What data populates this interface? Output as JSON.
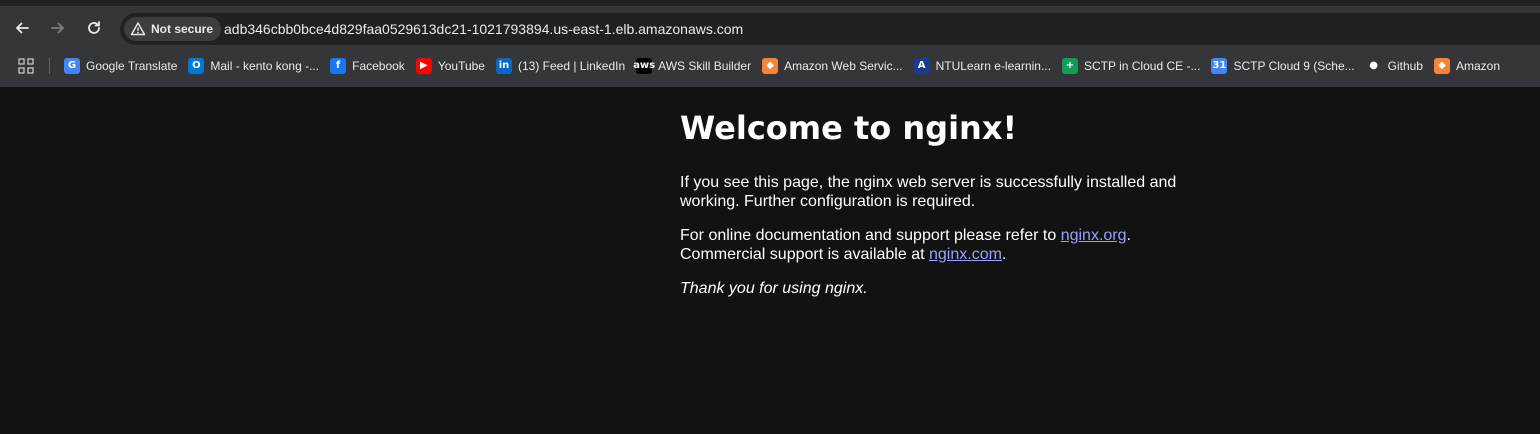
{
  "browser": {
    "security_label": "Not secure",
    "url": "adb346cbb0bce4d829faa0529613dc21-1021793894.us-east-1.elb.amazonaws.com",
    "bookmarks": [
      {
        "label": "Google Translate",
        "icon": "google-translate-icon",
        "color": "#4285f4",
        "glyph": "G"
      },
      {
        "label": "Mail - kento kong -...",
        "icon": "outlook-mail-icon",
        "color": "#0078d4",
        "glyph": "O"
      },
      {
        "label": "Facebook",
        "icon": "facebook-icon",
        "color": "#1877f2",
        "glyph": "f"
      },
      {
        "label": "YouTube",
        "icon": "youtube-icon",
        "color": "#ff0000",
        "glyph": "▶"
      },
      {
        "label": "(13) Feed | LinkedIn",
        "icon": "linkedin-icon",
        "color": "#0a66c2",
        "glyph": "in"
      },
      {
        "label": "AWS Skill Builder",
        "icon": "aws-icon",
        "color": "#000000",
        "glyph": "aws"
      },
      {
        "label": "Amazon Web Servic...",
        "icon": "aws-cube-icon",
        "color": "#f58536",
        "glyph": "◆"
      },
      {
        "label": "NTULearn e-learnin...",
        "icon": "ntulearn-icon",
        "color": "#1a3a8f",
        "glyph": "A"
      },
      {
        "label": "SCTP in Cloud CE -...",
        "icon": "google-sheets-icon",
        "color": "#0f9d58",
        "glyph": "+"
      },
      {
        "label": "SCTP Cloud 9 (Sche...",
        "icon": "google-calendar-icon",
        "color": "#4285f4",
        "glyph": "31"
      },
      {
        "label": "Github",
        "icon": "github-icon",
        "color": "#35363a",
        "glyph": "●"
      },
      {
        "label": "Amazon",
        "icon": "aws-cube-icon",
        "color": "#f58536",
        "glyph": "◆"
      }
    ]
  },
  "page": {
    "heading": "Welcome to nginx!",
    "p1": "If you see this page, the nginx web server is successfully installed and working. Further configuration is required.",
    "p2_before": "For online documentation and support please refer to ",
    "p2_link1": "nginx.org",
    "p2_middle": ". Commercial support is available at ",
    "p2_link2": "nginx.com",
    "p2_after": ".",
    "p3": "Thank you for using nginx."
  }
}
